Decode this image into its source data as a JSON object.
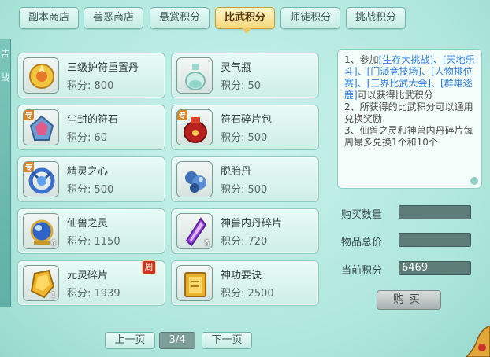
{
  "tabs": [
    {
      "label": "副本商店",
      "active": false
    },
    {
      "label": "善恶商店",
      "active": false
    },
    {
      "label": "悬赏积分",
      "active": false
    },
    {
      "label": "比武积分",
      "active": true
    },
    {
      "label": "师徒积分",
      "active": false
    },
    {
      "label": "挑战积分",
      "active": false
    }
  ],
  "items": [
    {
      "name": "三级护符重置丹",
      "price": "积分: 800",
      "icon": "gold-lotus-icon"
    },
    {
      "name": "灵气瓶",
      "price": "积分: 50",
      "icon": "spirit-vase-icon"
    },
    {
      "name": "尘封的符石",
      "price": "积分: 60",
      "icon": "rune-stone-icon",
      "tag": "专"
    },
    {
      "name": "符石碎片包",
      "price": "积分: 500",
      "icon": "red-pouch-icon",
      "tag": "专"
    },
    {
      "name": "精灵之心",
      "price": "积分: 500",
      "icon": "spirit-heart-icon",
      "tag": "专"
    },
    {
      "name": "脱胎丹",
      "price": "积分: 500",
      "icon": "blue-pill-icon"
    },
    {
      "name": "仙兽之灵",
      "price": "积分: 1150",
      "icon": "blue-orb-icon",
      "count": "6"
    },
    {
      "name": "神兽内丹碎片",
      "price": "积分: 720",
      "icon": "purple-crystal-icon",
      "count": "5"
    },
    {
      "name": "元灵碎片",
      "price": "积分: 1939",
      "icon": "gold-shard-icon",
      "count": "1",
      "badge": "周"
    },
    {
      "name": "神功要诀",
      "price": "积分: 2500",
      "icon": "gold-book-icon"
    }
  ],
  "info": {
    "line1_a": "1、参加",
    "line1_b": "[生存大挑战]、[天地乐斗]、[门派竞技场]、[人物排位赛]、[三界比武大会]、[群雄逐鹿]",
    "line1_c": "可以获得比武积分",
    "line2": "2、所获得的比武积分可以通用兑换奖励",
    "line3": "3、仙兽之灵和神兽内丹碎片每周最多兑换1个和10个"
  },
  "purchase": {
    "qty_label": "购买数量",
    "qty_value": "",
    "total_label": "物品总价",
    "total_value": "",
    "points_label": "当前积分",
    "points_value": "6469",
    "buy_label": "购买"
  },
  "pager": {
    "prev": "上一页",
    "page": "3/4",
    "next": "下一页"
  },
  "side_text": [
    "吉",
    "战"
  ],
  "colors": {
    "accent": "#f6d879",
    "panel": "#cdeee6",
    "link": "#2d7be0"
  }
}
